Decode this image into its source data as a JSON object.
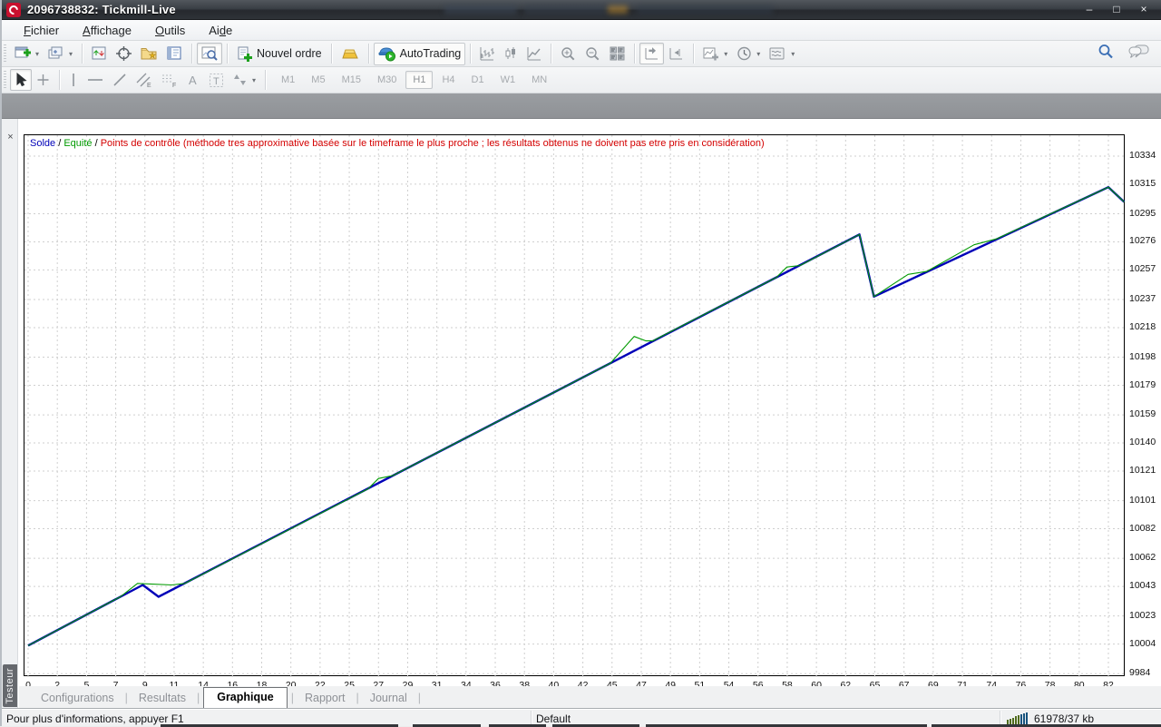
{
  "window": {
    "title": "2096738832: Tickmill-Live",
    "minimize": "–",
    "maximize": "□",
    "close": "×"
  },
  "menu": {
    "items": [
      {
        "pre": "",
        "u": "F",
        "post": "ichier"
      },
      {
        "pre": "",
        "u": "A",
        "post": "ffichage"
      },
      {
        "pre": "",
        "u": "O",
        "post": "utils"
      },
      {
        "pre": "Ai",
        "u": "d",
        "post": "e"
      }
    ]
  },
  "toolbar": {
    "nouvel_ordre": "Nouvel ordre",
    "autotrading": "AutoTrading",
    "timeframes": [
      "M1",
      "M5",
      "M15",
      "M30",
      "H1",
      "H4",
      "D1",
      "W1",
      "MN"
    ],
    "active_timeframe": "H1"
  },
  "tester": {
    "label": "Testeur",
    "close": "×",
    "tabs": [
      "Configurations",
      "Resultats",
      "Graphique",
      "Rapport",
      "Journal"
    ],
    "active_tab": "Graphique"
  },
  "statusbar": {
    "help": "Pour plus d'informations, appuyer F1",
    "profile": "Default",
    "traffic": "61978/37 kb"
  },
  "chart_data": {
    "type": "line",
    "title": "Graphique de backtest (Solde / Equité)",
    "legend": {
      "solde": "Solde",
      "equite": "Equité",
      "points": "Points de contrôle (méthode tres approximative basée sur le timeframe le plus proche ; les résultats obtenus ne doivent pas etre pris en considération)",
      "separator": "/"
    },
    "colors": {
      "solde": "#0000b8",
      "equite": "#009a00",
      "points": "#d40000",
      "grid": "#cfcfcf"
    },
    "x_ticks": [
      0,
      2,
      5,
      7,
      9,
      11,
      14,
      16,
      18,
      20,
      22,
      25,
      27,
      29,
      31,
      34,
      36,
      38,
      40,
      42,
      45,
      47,
      49,
      51,
      54,
      56,
      58,
      60,
      62,
      65,
      67,
      69,
      71,
      74,
      76,
      78,
      80,
      82
    ],
    "y_ticks": [
      9984,
      10004,
      10023,
      10043,
      10062,
      10082,
      10101,
      10121,
      10140,
      10159,
      10179,
      10198,
      10218,
      10237,
      10257,
      10276,
      10295,
      10315,
      10334
    ],
    "x_range": [
      0,
      83.3
    ],
    "y_range": [
      9981,
      10348
    ],
    "grid": "dashed",
    "legend_position": "top-left",
    "series": [
      {
        "name": "Solde",
        "color_key": "solde",
        "width": 2.4,
        "points": [
          [
            0,
            10003
          ],
          [
            8.7,
            10044
          ],
          [
            9.9,
            10036
          ],
          [
            63.1,
            10281
          ],
          [
            64.2,
            10239
          ],
          [
            82.0,
            10313
          ],
          [
            83.2,
            10303
          ]
        ]
      },
      {
        "name": "Equité",
        "color_key": "equite",
        "width": 1.1,
        "points": [
          [
            0,
            10003
          ],
          [
            7.0,
            10036
          ],
          [
            8.3,
            10045
          ],
          [
            10.9,
            10044
          ],
          [
            11.9,
            10045
          ],
          [
            25.8,
            10109
          ],
          [
            26.6,
            10116
          ],
          [
            27.7,
            10118
          ],
          [
            44.2,
            10194
          ],
          [
            46.0,
            10212
          ],
          [
            46.9,
            10209
          ],
          [
            47.4,
            10209
          ],
          [
            56.8,
            10252
          ],
          [
            57.6,
            10259
          ],
          [
            58.6,
            10260
          ],
          [
            63.1,
            10281
          ],
          [
            64.2,
            10239
          ],
          [
            66.8,
            10254
          ],
          [
            68.2,
            10256
          ],
          [
            71.8,
            10274
          ],
          [
            73.5,
            10278
          ],
          [
            82.0,
            10313
          ],
          [
            83.2,
            10303
          ]
        ]
      }
    ]
  }
}
